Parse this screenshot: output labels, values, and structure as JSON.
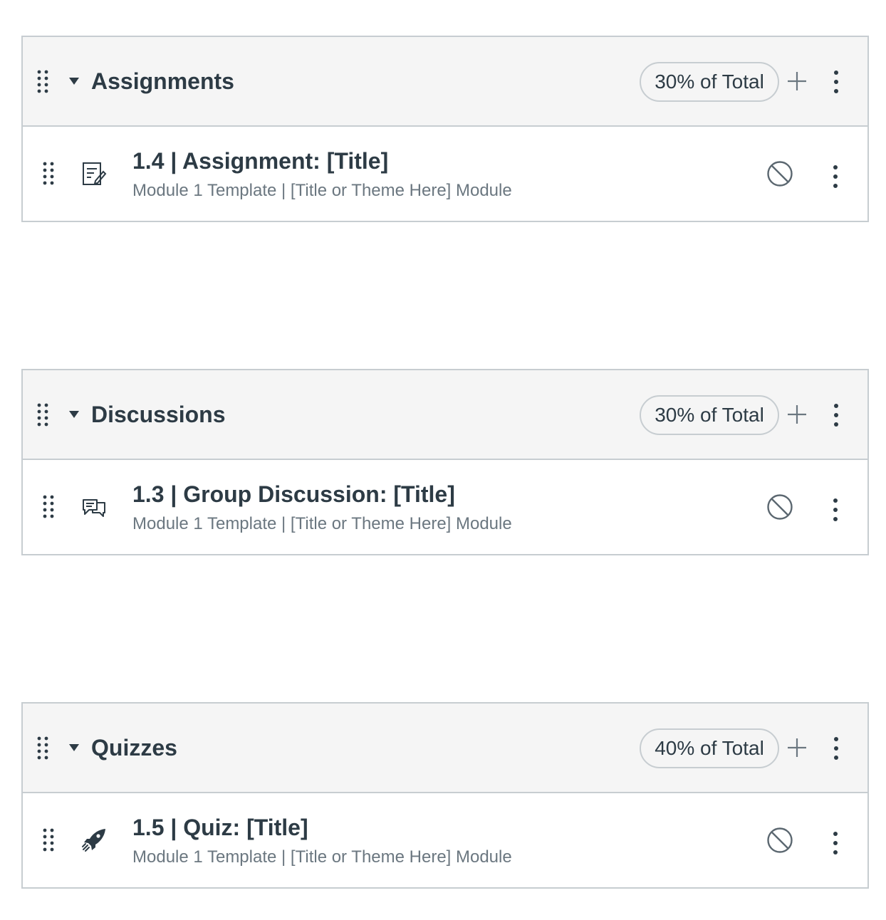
{
  "groups": [
    {
      "title": "Assignments",
      "weight": "30% of Total",
      "item": {
        "icon": "assignment-icon",
        "title": "1.4 | Assignment: [Title]",
        "subtitle": "Module 1 Template | [Title or Theme Here] Module"
      }
    },
    {
      "title": "Discussions",
      "weight": "30% of Total",
      "item": {
        "icon": "discussion-icon",
        "title": "1.3 | Group Discussion: [Title]",
        "subtitle": "Module 1 Template | [Title or Theme Here] Module"
      }
    },
    {
      "title": "Quizzes",
      "weight": "40% of Total",
      "item": {
        "icon": "quiz-rocket-icon",
        "title": "1.5 | Quiz: [Title]",
        "subtitle": "Module 1 Template | [Title or Theme Here] Module"
      }
    }
  ],
  "colors": {
    "text": "#2d3b45",
    "muted": "#6b7780",
    "border": "#c7cdd1",
    "header_bg": "#f5f5f5"
  }
}
